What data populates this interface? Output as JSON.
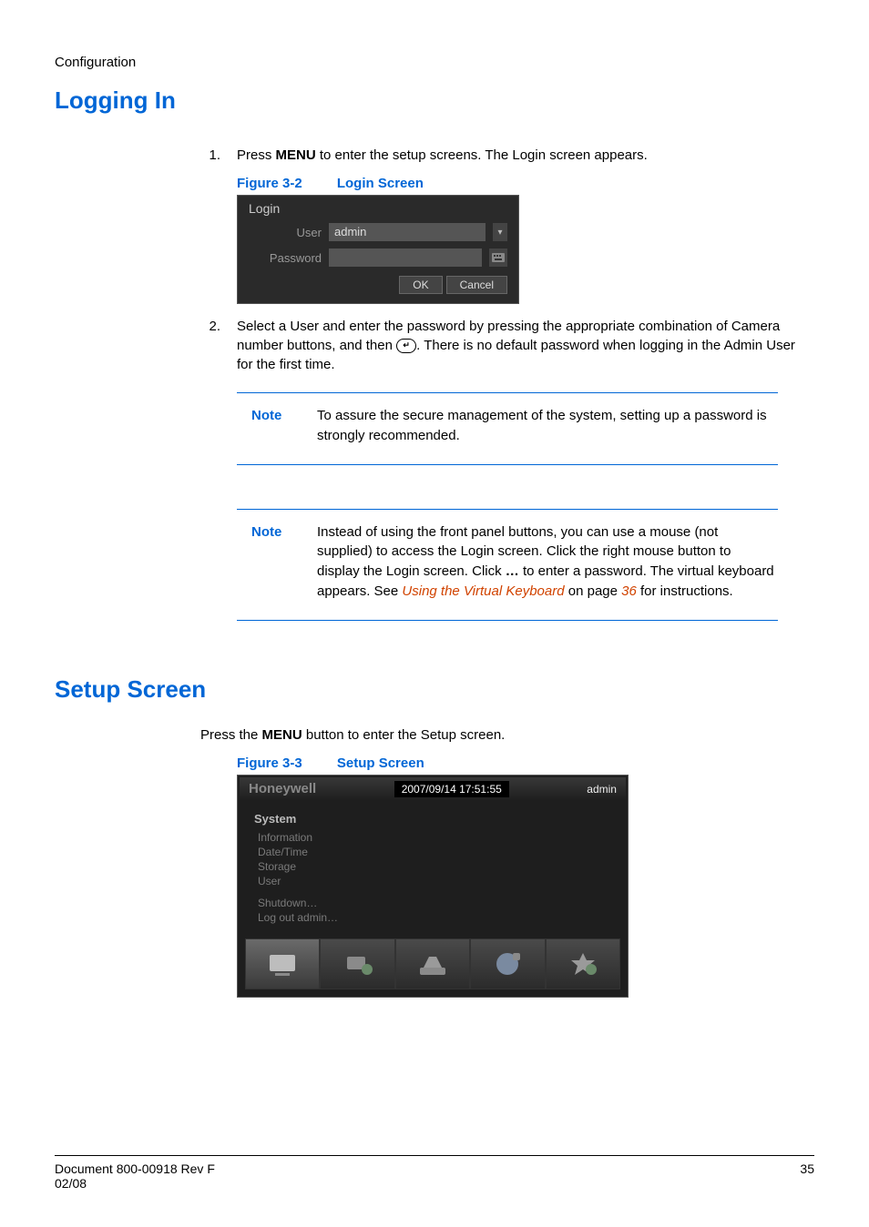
{
  "breadcrumb": "Configuration",
  "h1_logging_in": "Logging In",
  "step1": {
    "num": "1.",
    "pre": "Press ",
    "bold": "MENU",
    "post": " to enter the setup screens. The Login screen appears."
  },
  "fig32": {
    "label": "Figure 3-2",
    "title": "Login Screen"
  },
  "login": {
    "title": "Login",
    "user_label": "User",
    "user_value": "admin",
    "password_label": "Password",
    "password_value": "",
    "ok": "OK",
    "cancel": "Cancel"
  },
  "step2": {
    "num": "2.",
    "line1": "Select a User and enter the password by pressing the appropriate combination of Camera number buttons, and then ",
    "enter_glyph": "↵",
    "line2": ". There is no default password when logging in the Admin User for the first time."
  },
  "note1": {
    "label": "Note",
    "body": "To assure the secure management of the system, setting up a password is strongly recommended."
  },
  "note2": {
    "label": "Note",
    "body1": "Instead of using the front panel buttons, you can use a mouse (not supplied) to access the Login screen. Click the right mouse button to display the Login screen. Click ",
    "ellipsis": "…",
    "body2": " to enter a password. The virtual keyboard appears. See ",
    "link": "Using the Virtual Keyboard",
    "body3": " on page ",
    "page": "36",
    "body4": " for instructions."
  },
  "h1_setup": "Setup Screen",
  "setup_intro": {
    "pre": "Press the ",
    "bold": "MENU",
    "post": " button to enter the Setup screen."
  },
  "fig33": {
    "label": "Figure 3-3",
    "title": "Setup Screen"
  },
  "setup": {
    "brand": "Honeywell",
    "datetime": "2007/09/14  17:51:55",
    "user": "admin",
    "system": "System",
    "items": [
      "Information",
      "Date/Time",
      "Storage",
      "User"
    ],
    "shutdown": "Shutdown…",
    "logout": "Log out admin…"
  },
  "footer": {
    "left1": "Document 800-00918 Rev F",
    "left2": "02/08",
    "right": "35"
  }
}
